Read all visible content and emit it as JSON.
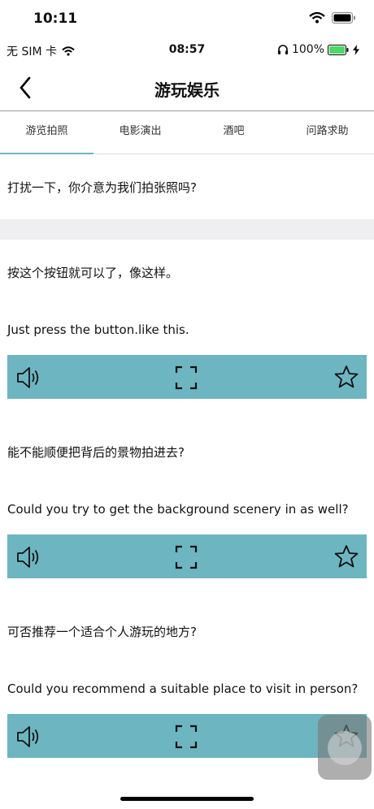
{
  "status_bar": {
    "time": "10:11"
  },
  "system_bar": {
    "carrier": "无 SIM 卡",
    "time": "08:57",
    "battery": "100%"
  },
  "nav": {
    "title": "游玩娱乐"
  },
  "tabs": [
    "游览拍照",
    "电影演出",
    "酒吧",
    "问路求助"
  ],
  "first_question": "打扰一下，你介意为我们拍张照吗?",
  "phrases": [
    {
      "zh": "按这个按钮就可以了，像这样。",
      "en": "Just press the button.like this."
    },
    {
      "zh": "能不能顺便把背后的景物拍进去?",
      "en": "Could you try to get the background scenery in as well?"
    },
    {
      "zh": "可否推荐一个适合个人游玩的地方?",
      "en": "Could you recommend a suitable place to visit in person?"
    }
  ],
  "colors": {
    "accent": "#6db5c1",
    "separator": "#efeff2",
    "battery": "#4cd964"
  }
}
